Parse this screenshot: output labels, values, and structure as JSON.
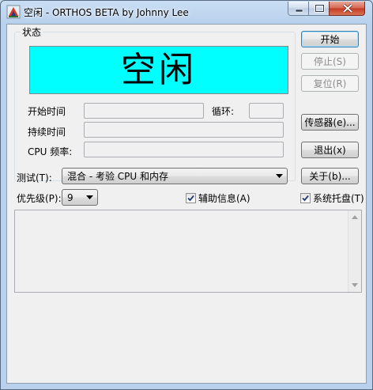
{
  "window": {
    "title": "空闲 - ORTHOS BETA by Johnny Lee"
  },
  "status": {
    "group_label": "状态",
    "display_text": "空闲",
    "display_color": "#00ffff"
  },
  "labels": {
    "start_time": "开始时间",
    "loop": "循环:",
    "duration": "持续时间",
    "cpu_freq": "CPU 频率:",
    "test": "测试(T):",
    "priority": "优先级(P):"
  },
  "buttons": {
    "start": "开始",
    "stop": "停止(S)",
    "reset": "复位(R)",
    "sensors": "传感器(e)...",
    "exit": "退出(x)",
    "about": "关于(b)..."
  },
  "test_select": {
    "value": "混合 - 考验 CPU 和内存"
  },
  "priority_select": {
    "value": "9"
  },
  "checkboxes": {
    "aux_info": {
      "label": "辅助信息(A)",
      "checked": true
    },
    "tray": {
      "label": "系统托盘(T)",
      "checked": true
    }
  }
}
